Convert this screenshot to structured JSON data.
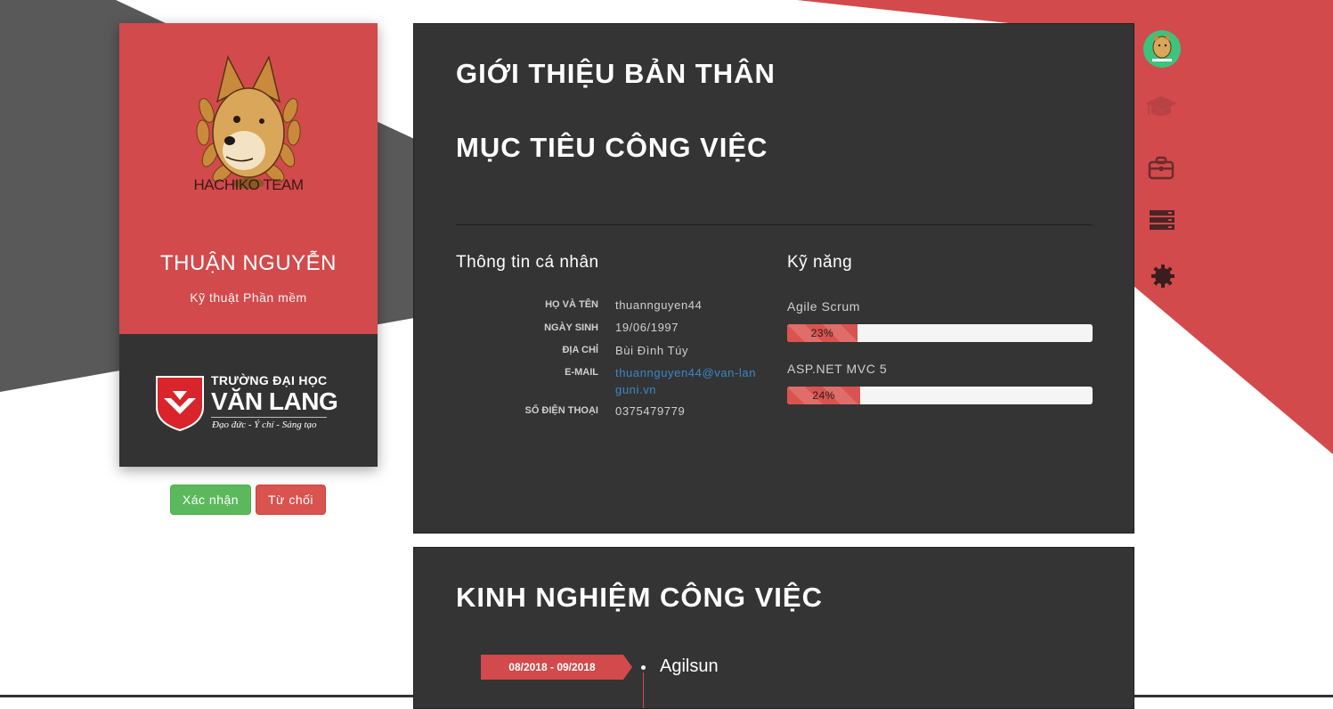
{
  "profile": {
    "team_text": "HACHIKO TEAM",
    "name": "THUẬN NGUYỄN",
    "major": "Kỹ thuật Phần mềm",
    "university": {
      "line1": "TRƯỜNG ĐẠI HỌC",
      "line2": "VĂN LANG",
      "motto": "Đạo đức - Ý chí - Sáng tạo"
    }
  },
  "actions": {
    "confirm_label": "Xác nhận",
    "reject_label": "Từ chối"
  },
  "about": {
    "title": "GIỚI THIỆU BẢN THÂN",
    "goal_title": "MỤC TIÊU CÔNG VIỆC",
    "personal_title": "Thông tin cá nhân",
    "info": [
      {
        "label": "HỌ VÀ TÊN",
        "value": "thuannguyen44"
      },
      {
        "label": "NGÀY SINH",
        "value": "19/06/1997"
      },
      {
        "label": "ĐỊA CHỈ",
        "value": "Bùi Đình Túy"
      },
      {
        "label": "E-MAIL",
        "value": "thuannguyen44@van-languni.vn"
      },
      {
        "label": "SỐ ĐIỆN THOẠI",
        "value": "0375479779"
      }
    ],
    "skills_title": "Kỹ năng",
    "skills": [
      {
        "name": "Agile Scrum",
        "percent": 23,
        "percent_label": "23%"
      },
      {
        "name": "ASP.NET MVC 5",
        "percent": 24,
        "percent_label": "24%"
      }
    ]
  },
  "experience": {
    "title": "KINH NGHIỆM CÔNG VIỆC",
    "items": [
      {
        "date": "08/2018 - 09/2018",
        "company": "Agilsun"
      }
    ]
  },
  "nav": {
    "items": [
      "avatar",
      "graduation-cap-icon",
      "briefcase-icon",
      "server-icon",
      "gear-icon"
    ]
  },
  "colors": {
    "accent_red": "#d24a4c",
    "panel_dark": "#343434",
    "confirm_green": "#5cb85c",
    "reject_red": "#d9534f",
    "link_blue": "#3a87c8"
  }
}
